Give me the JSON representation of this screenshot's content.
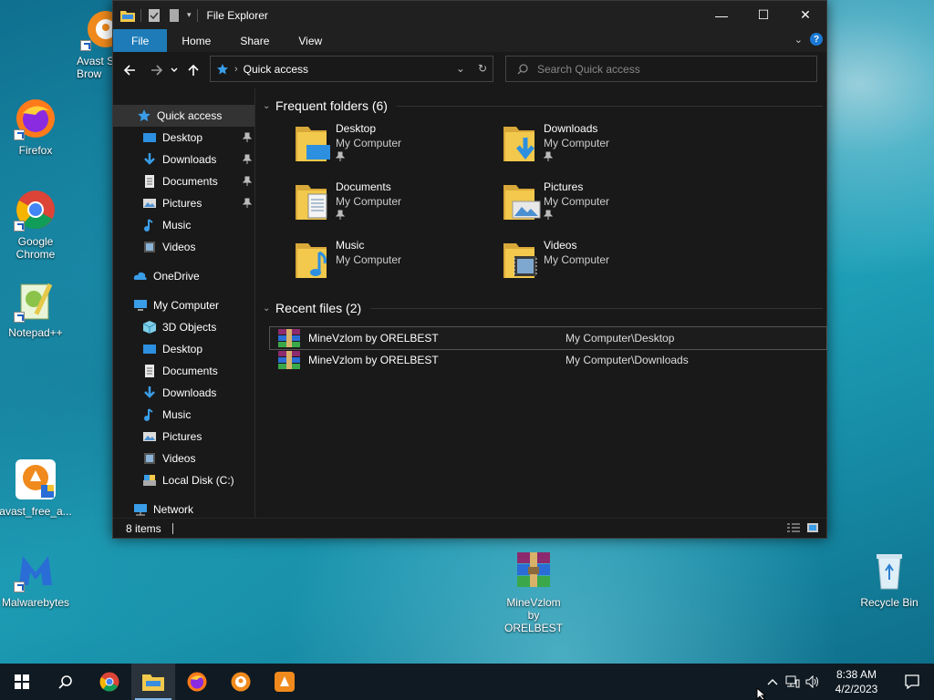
{
  "desktop": {
    "icons_left": [
      {
        "label": "Avast Secure Browser",
        "display": "Avast S\nBrow"
      },
      {
        "label": "Firefox"
      },
      {
        "label": "Google Chrome",
        "display": "Google\nChrome"
      },
      {
        "label": "Notepad++"
      },
      {
        "label": "avast_free_a..."
      },
      {
        "label": "Malwarebytes"
      }
    ],
    "center_icon": {
      "label_line1": "MineVzlom",
      "label_line2": "by ORELBEST"
    },
    "recycle_bin": {
      "label": "Recycle Bin"
    }
  },
  "window": {
    "title": "File Explorer",
    "controls": {
      "minimize": "—",
      "maximize": "☐",
      "close": "✕"
    },
    "ribbon": {
      "tabs": [
        "File",
        "Home",
        "Share",
        "View"
      ]
    },
    "address": {
      "path": "Quick access"
    },
    "search": {
      "placeholder": "Search Quick access"
    },
    "sidebar": {
      "quick_access": "Quick access",
      "qa_items": [
        "Desktop",
        "Downloads",
        "Documents",
        "Pictures",
        "Music",
        "Videos"
      ],
      "onedrive": "OneDrive",
      "my_computer": "My Computer",
      "mc_items": [
        "3D Objects",
        "Desktop",
        "Documents",
        "Downloads",
        "Music",
        "Pictures",
        "Videos",
        "Local Disk (C:)"
      ],
      "network": "Network"
    },
    "frequent": {
      "header": "Frequent folders (6)",
      "folders": [
        {
          "name": "Desktop",
          "location": "My Computer",
          "pinned": true
        },
        {
          "name": "Downloads",
          "location": "My Computer",
          "pinned": true
        },
        {
          "name": "Documents",
          "location": "My Computer",
          "pinned": true
        },
        {
          "name": "Pictures",
          "location": "My Computer",
          "pinned": true
        },
        {
          "name": "Music",
          "location": "My Computer",
          "pinned": false
        },
        {
          "name": "Videos",
          "location": "My Computer",
          "pinned": false
        }
      ]
    },
    "recent": {
      "header": "Recent files (2)",
      "files": [
        {
          "name": "MineVzlom by ORELBEST",
          "path": "My Computer\\Desktop"
        },
        {
          "name": "MineVzlom by ORELBEST",
          "path": "My Computer\\Downloads"
        }
      ]
    },
    "status": {
      "count": "8 items"
    }
  },
  "taskbar": {
    "time": "8:38 AM",
    "date": "4/2/2023"
  },
  "colors": {
    "accent": "#1e7bb8",
    "window_bg": "#191919",
    "titlebar_bg": "#202020",
    "folder_yellow": "#f2c94c",
    "taskbar_bg": "#0f1a22"
  }
}
